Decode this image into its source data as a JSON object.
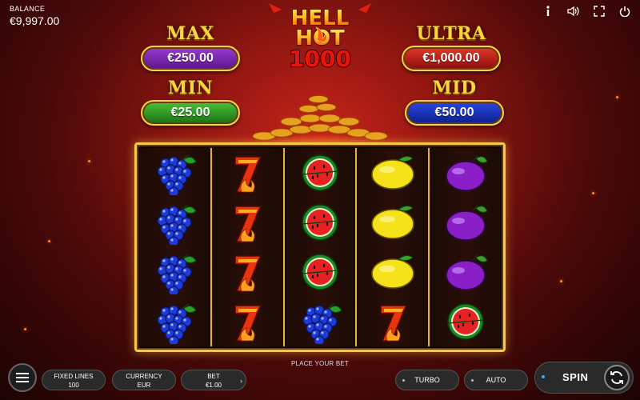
{
  "balance": {
    "label": "BALANCE",
    "value": "€9,997.00"
  },
  "top_icons": [
    "info-icon",
    "sound-icon",
    "fullscreen-icon",
    "power-icon"
  ],
  "logo": {
    "line1": "HELL",
    "line2": "HOT",
    "line3": "1000"
  },
  "jackpots": {
    "max": {
      "name": "MAX",
      "amount": "€250.00",
      "color": "#7a24b4"
    },
    "ultra": {
      "name": "ULTRA",
      "amount": "€1,000.00",
      "color": "#c01f1a"
    },
    "min": {
      "name": "MIN",
      "amount": "€25.00",
      "color": "#2e9a22"
    },
    "mid": {
      "name": "MID",
      "amount": "€50.00",
      "color": "#1a2ec0"
    }
  },
  "reels": [
    [
      "grapes",
      "grapes",
      "grapes",
      "grapes"
    ],
    [
      "seven",
      "seven",
      "seven",
      "seven"
    ],
    [
      "watermelon",
      "watermelon",
      "watermelon",
      "grapes"
    ],
    [
      "lemon",
      "lemon",
      "lemon",
      "seven"
    ],
    [
      "plum",
      "plum",
      "plum",
      "watermelon"
    ]
  ],
  "bottom": {
    "place_bet": "PLACE YOUR BET",
    "fixed_lines_label": "FIXED LINES",
    "fixed_lines_value": "100",
    "currency_label": "CURRENCY",
    "currency_value": "EUR",
    "bet_label": "BET",
    "bet_value": "€1.00",
    "turbo_label": "TURBO",
    "auto_label": "AUTO",
    "spin_label": "SPIN"
  },
  "colors": {
    "gold": "#f5c84a",
    "background_red": "#8e1610",
    "spin_dot": "#3aa8ff"
  }
}
